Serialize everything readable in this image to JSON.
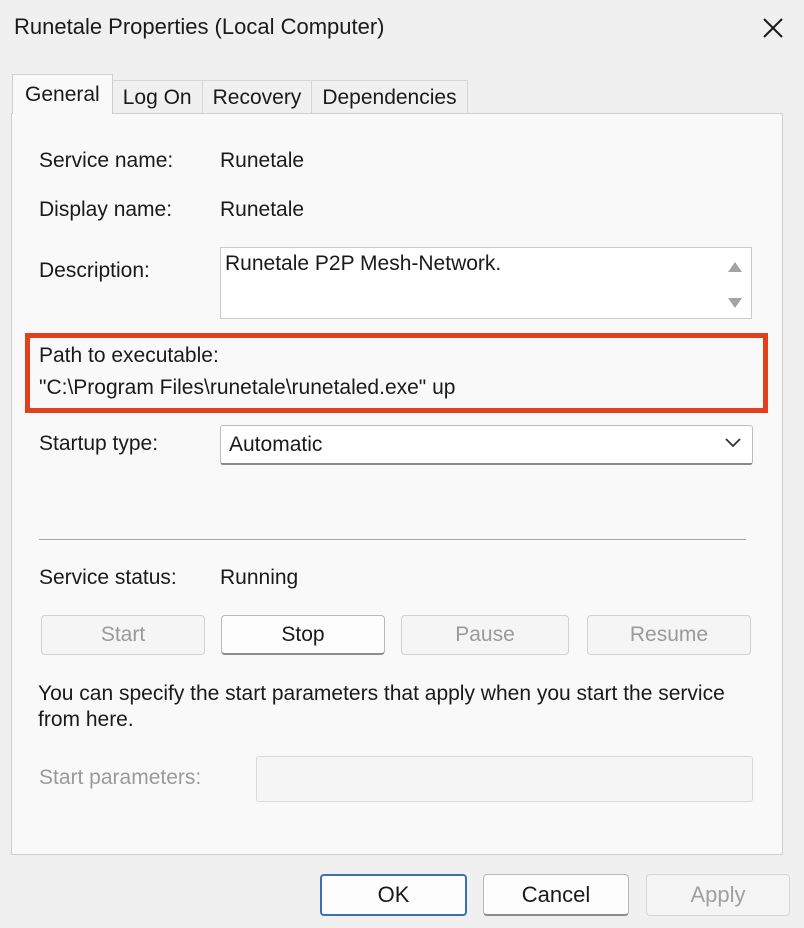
{
  "window": {
    "title": "Runetale Properties (Local Computer)"
  },
  "tabs": [
    {
      "label": "General",
      "active": true
    },
    {
      "label": "Log On",
      "active": false
    },
    {
      "label": "Recovery",
      "active": false
    },
    {
      "label": "Dependencies",
      "active": false
    }
  ],
  "general": {
    "service_name_label": "Service name:",
    "service_name": "Runetale",
    "display_name_label": "Display name:",
    "display_name": "Runetale",
    "description_label": "Description:",
    "description": "Runetale P2P Mesh-Network.",
    "path_label": "Path to executable:",
    "path": "\"C:\\Program Files\\runetale\\runetaled.exe\" up",
    "startup_type_label": "Startup type:",
    "startup_type": "Automatic",
    "service_status_label": "Service status:",
    "service_status": "Running",
    "buttons": {
      "start": "Start",
      "stop": "Stop",
      "pause": "Pause",
      "resume": "Resume"
    },
    "note": "You can specify the start parameters that apply when you start the service from here.",
    "start_params_label": "Start parameters:",
    "start_params_value": ""
  },
  "footer": {
    "ok": "OK",
    "cancel": "Cancel",
    "apply": "Apply"
  },
  "colors": {
    "highlight": "#e2401c",
    "ok_border": "#3c6fb3"
  },
  "icons": {
    "close": "close-icon",
    "chevron": "chevron-down-icon",
    "scroll_up": "scroll-up-arrow-icon",
    "scroll_down": "scroll-down-arrow-icon"
  }
}
